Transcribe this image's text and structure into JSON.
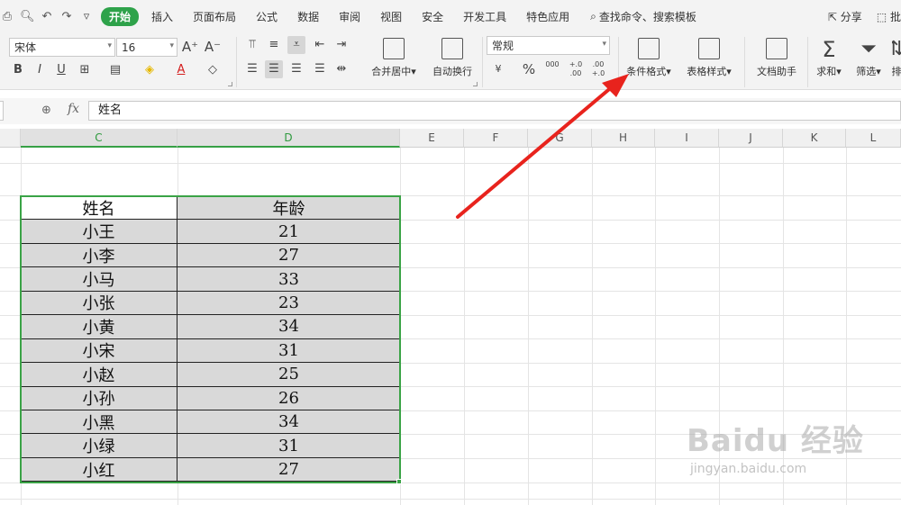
{
  "menubar": {
    "tabs": [
      "开始",
      "插入",
      "页面布局",
      "公式",
      "数据",
      "审阅",
      "视图",
      "安全",
      "开发工具",
      "特色应用"
    ],
    "active_tab": "开始",
    "search_label": "查找命令、搜索模板",
    "share_label": "分享",
    "batch_label": "批"
  },
  "ribbon": {
    "font_name": "宋体",
    "font_size": "16",
    "number_format": "常规",
    "merge_label": "合并居中",
    "wrap_label": "自动换行",
    "cond_format_label": "条件格式",
    "table_style_label": "表格样式",
    "doc_helper_label": "文档助手",
    "sum_label": "求和",
    "filter_label": "筛选",
    "sort_label": "排",
    "currency_symbol": "¥",
    "percent_symbol": "%",
    "thousands_symbol": "000",
    "inc_decimal": "+.0\n.00",
    "dec_decimal": ".00\n+.0"
  },
  "formula_bar": {
    "fx_label": "fx",
    "value": "姓名"
  },
  "columns": [
    "C",
    "D",
    "E",
    "F",
    "G",
    "H",
    "I",
    "J",
    "K",
    "L"
  ],
  "selected_columns": [
    "C",
    "D"
  ],
  "table": {
    "headers": [
      "姓名",
      "年龄"
    ],
    "rows": [
      [
        "小王",
        "21"
      ],
      [
        "小李",
        "27"
      ],
      [
        "小马",
        "33"
      ],
      [
        "小张",
        "23"
      ],
      [
        "小黄",
        "34"
      ],
      [
        "小宋",
        "31"
      ],
      [
        "小赵",
        "25"
      ],
      [
        "小孙",
        "26"
      ],
      [
        "小黑",
        "34"
      ],
      [
        "小绿",
        "31"
      ],
      [
        "小红",
        "27"
      ]
    ]
  },
  "watermark": {
    "main": "Baidu 经验",
    "sub": "jingyan.baidu.com"
  },
  "colors": {
    "accent_green": "#2ea24a",
    "selection_green": "#3aa346",
    "arrow_red": "#e8231d",
    "cell_fill": "#d9d9d9"
  }
}
